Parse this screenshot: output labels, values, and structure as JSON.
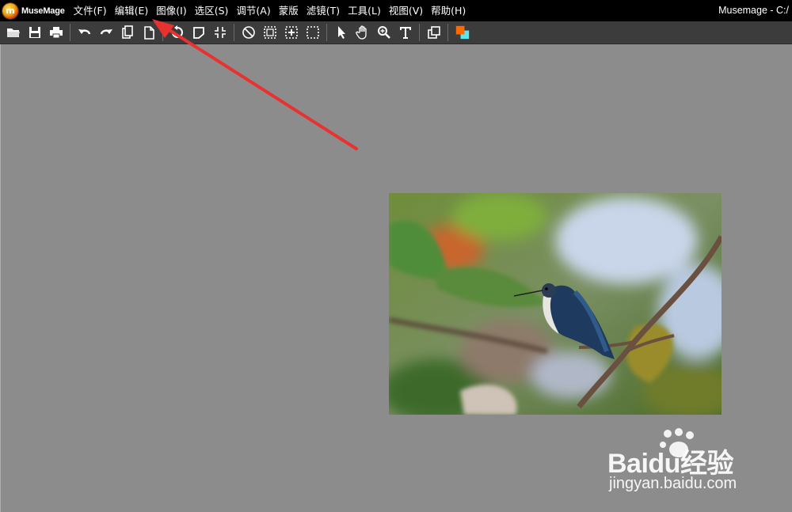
{
  "app": {
    "brand": "MuseMage",
    "title": "Musemage - C:/"
  },
  "menu": [
    "文件(F)",
    "编辑(E)",
    "图像(I)",
    "选区(S)",
    "调节(A)",
    "蒙版",
    "滤镜(T)",
    "工具(L)",
    "视图(V)",
    "帮助(H)"
  ],
  "toolbar": {
    "groups": [
      [
        "open-folder-icon",
        "save-icon",
        "print-icon"
      ],
      [
        "undo-icon",
        "redo-icon",
        "copy-icon",
        "paste-icon"
      ],
      [
        "rotate-icon",
        "flip-icon",
        "crop-icon"
      ],
      [
        "deselect-icon",
        "select-all-icon",
        "select-expand-icon",
        "select-contract-icon"
      ],
      [
        "pointer-icon",
        "hand-icon",
        "zoom-icon",
        "text-icon"
      ],
      [
        "layers-icon"
      ],
      [
        "color-swatch-icon"
      ]
    ],
    "colors": {
      "foreground": "#ff6a00",
      "background": "#5ce6f0"
    }
  },
  "watermark": {
    "brand": "Baidu经验",
    "url": "jingyan.baidu.com"
  },
  "annotation": {
    "arrow_color": "#e8322f"
  }
}
